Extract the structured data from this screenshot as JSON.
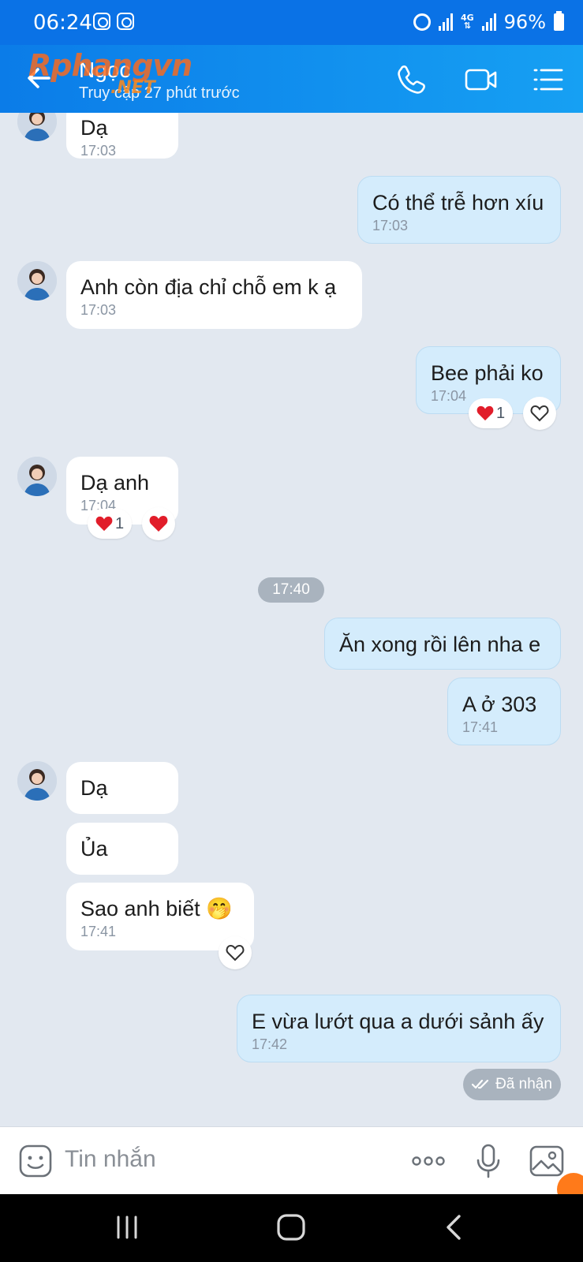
{
  "status": {
    "time": "06:24",
    "net": "4G",
    "battery": "96%"
  },
  "header": {
    "title": "Ngọc",
    "subtitle": "Truy cập 27 phút trước",
    "watermark": "Rphangvn",
    "watermark_sub": ".NET"
  },
  "messages": [
    {
      "dir": "in",
      "text": "Dạ",
      "time": "17:03"
    },
    {
      "dir": "out",
      "text": "Có thể trễ hơn xíu",
      "time": "17:03"
    },
    {
      "dir": "in",
      "text": "Anh còn địa chỉ chỗ em k ạ",
      "time": "17:03"
    },
    {
      "dir": "out",
      "text": "Bee phải ko",
      "time": "17:04",
      "reaction_count": "1"
    },
    {
      "dir": "in",
      "text": "Dạ anh",
      "time": "17:04",
      "reaction_count": "1"
    },
    {
      "dir": "out",
      "text": "Ăn xong rồi lên nha e"
    },
    {
      "dir": "out",
      "text": "A ở 303",
      "time": "17:41"
    },
    {
      "dir": "in",
      "text": "Dạ"
    },
    {
      "dir": "in",
      "text": "Ủa"
    },
    {
      "dir": "in",
      "text": "Sao anh biết 🤭",
      "time": "17:41"
    },
    {
      "dir": "out",
      "text": "E vừa lướt qua a dưới sảnh ấy",
      "time": "17:42"
    }
  ],
  "time_divider": "17:40",
  "delivery_status": "Đã nhận",
  "input": {
    "placeholder": "Tin nhắn"
  },
  "icons": {
    "back": "back-arrow-icon",
    "call": "phone-icon",
    "video": "video-icon",
    "menu": "list-menu-icon",
    "sticker": "sticker-icon",
    "more": "more-icon",
    "mic": "mic-icon",
    "image": "image-icon"
  },
  "colors": {
    "header": "#0b7ce8",
    "bubble_out": "#d4ecfc",
    "bubble_in": "#ffffff",
    "background": "#e2e8f0",
    "heart": "#e11d2a"
  }
}
